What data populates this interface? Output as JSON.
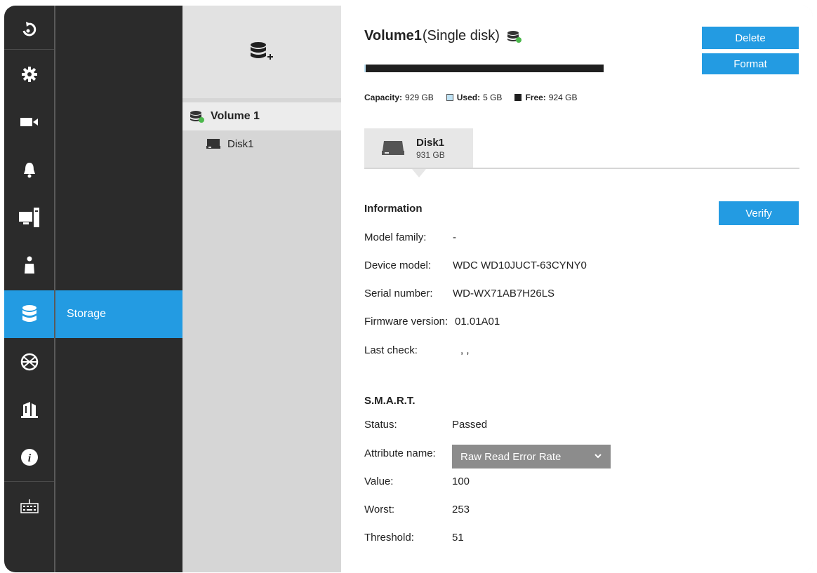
{
  "rail": {
    "items": [
      {
        "name": "home-back-icon"
      },
      {
        "name": "gear-icon"
      },
      {
        "name": "camera-icon"
      },
      {
        "name": "bell-icon"
      },
      {
        "name": "computer-icon"
      },
      {
        "name": "person-icon"
      },
      {
        "name": "database-icon",
        "active": true
      },
      {
        "name": "network-globe-icon"
      },
      {
        "name": "security-building-icon"
      },
      {
        "name": "info-icon"
      },
      {
        "name": "keyboard-icon"
      }
    ]
  },
  "subnav": {
    "active_label": "Storage"
  },
  "tree": {
    "add_icon": "add-volume-icon",
    "volume_label": "Volume 1",
    "disk_label": "Disk1"
  },
  "volume": {
    "name": "Volume1",
    "type": "(Single disk)",
    "delete_label": "Delete",
    "format_label": "Format",
    "used_fraction": 0.005,
    "capacity_label": "Capacity:",
    "capacity_value": "929 GB",
    "used_label": "Used:",
    "used_value": "5 GB",
    "free_label": "Free:",
    "free_value": "924 GB"
  },
  "disk_tab": {
    "name": "Disk1",
    "size": "931 GB"
  },
  "information": {
    "title": "Information",
    "verify_label": "Verify",
    "rows": [
      {
        "label": "Model family:",
        "value": "-"
      },
      {
        "label": "Device model:",
        "value": "WDC WD10JUCT-63CYNY0"
      },
      {
        "label": "Serial number:",
        "value": "WD-WX71AB7H26LS"
      },
      {
        "label": "Firmware version:",
        "value": "01.01A01"
      },
      {
        "label": "Last check:",
        "value": ", ,"
      }
    ]
  },
  "smart": {
    "title": "S.M.A.R.T.",
    "status_label": "Status:",
    "status_value": "Passed",
    "attribute_label": "Attribute name:",
    "attribute_selected": "Raw Read Error Rate",
    "value_label": "Value:",
    "value_value": "100",
    "worst_label": "Worst:",
    "worst_value": "253",
    "threshold_label": "Threshold:",
    "threshold_value": "51"
  },
  "colors": {
    "accent": "#239be2",
    "rail": "#2b2b2b",
    "status_green": "#4cb84c"
  }
}
